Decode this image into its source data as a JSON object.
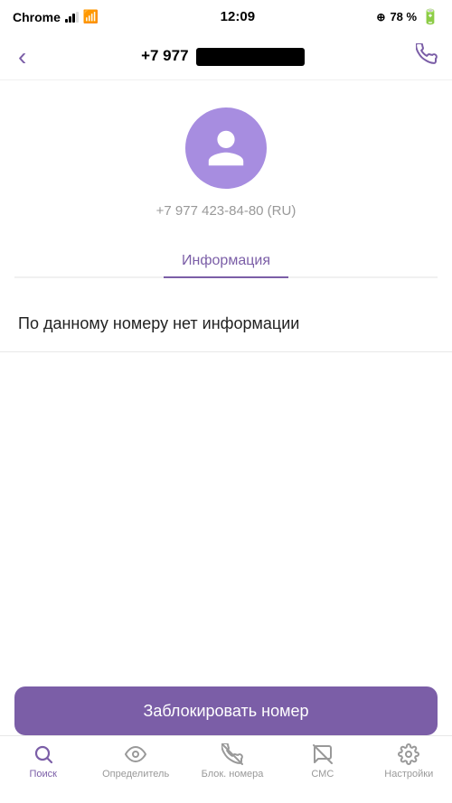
{
  "statusBar": {
    "appName": "Chrome",
    "time": "12:09",
    "battery": "78 %"
  },
  "navHeader": {
    "backLabel": "‹",
    "phoneNumber": "+7 977",
    "callLabel": "📞"
  },
  "contact": {
    "phoneNumberFull": "+7 977 423-84-80 (RU)"
  },
  "tabs": [
    {
      "label": "Информация",
      "active": true
    }
  ],
  "noInfoMessage": "По данному номеру нет информации",
  "blockButton": {
    "label": "Заблокировать номер"
  },
  "bottomNav": [
    {
      "label": "Поиск",
      "active": true
    },
    {
      "label": "Определитель",
      "active": false
    },
    {
      "label": "Блок. номера",
      "active": false
    },
    {
      "label": "СМС",
      "active": false
    },
    {
      "label": "Настройки",
      "active": false
    }
  ]
}
